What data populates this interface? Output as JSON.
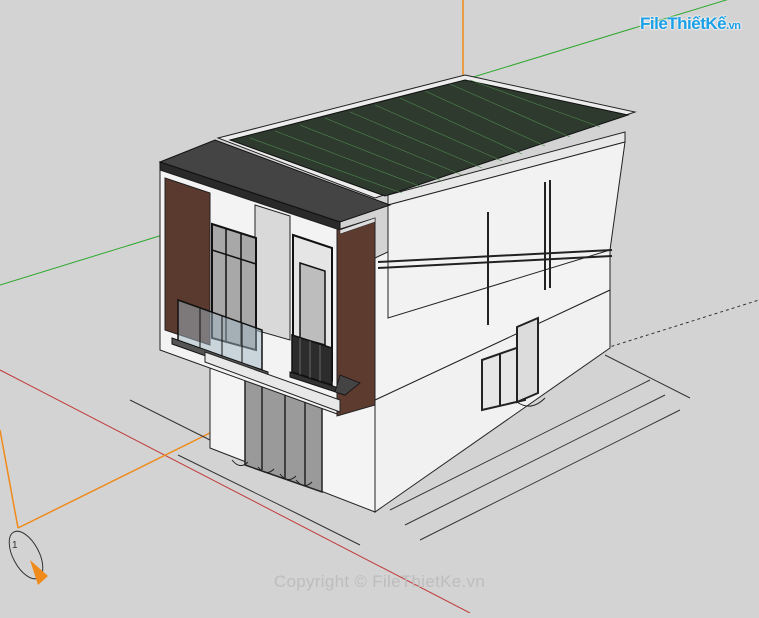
{
  "brand": {
    "logo_text": "FileThiếtKế",
    "logo_suffix": ".vn"
  },
  "watermark": "Copyright © FileThietKe.vn",
  "axis_marker_label": "1",
  "colors": {
    "background": "#d3d3d3",
    "green_axis": "#2fa82f",
    "red_axis": "#c23a3a",
    "blue_axis": "#3b3bb3",
    "orange_guide": "#f08a1a",
    "roof": "#2e3a2e",
    "wall": "#f1f1f1",
    "wood_panel": "#5a3a2e",
    "brand": "#1aa0e8"
  }
}
